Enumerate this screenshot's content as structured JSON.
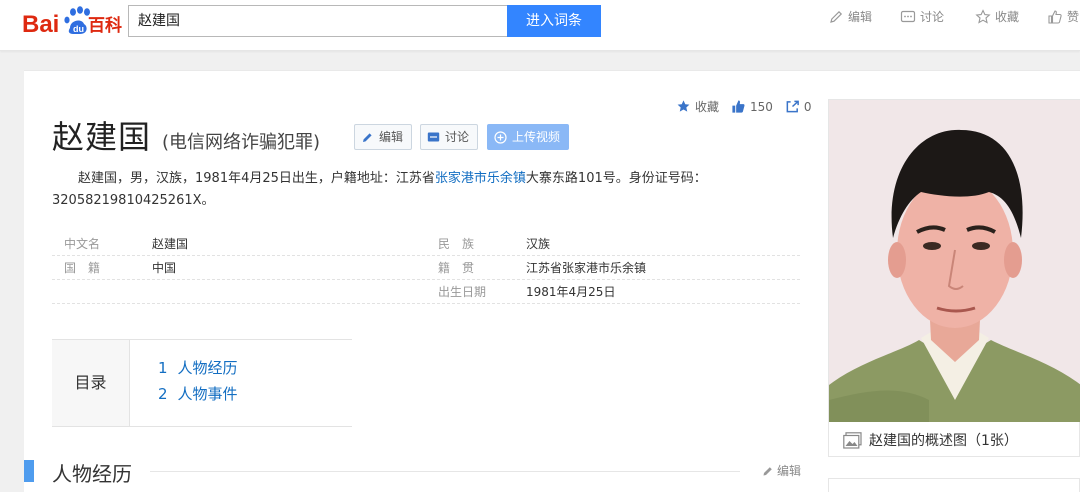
{
  "header": {
    "logo_text_left": "Bai",
    "logo_text_right": "百科",
    "search_value": "赵建国",
    "search_button": "进入词条",
    "actions": [
      "编辑",
      "讨论",
      "收藏",
      "赞"
    ]
  },
  "stats": {
    "collect_label": "收藏",
    "likes": "150",
    "shares": "0"
  },
  "entry": {
    "title": "赵建国",
    "subtitle": "(电信网络诈骗犯罪)",
    "edit_button": "编辑",
    "discuss_button": "讨论",
    "upload_button": "上传视频"
  },
  "summary": {
    "part1": "赵建国，男，汉族，1981年4月25日出生，户籍地址：江苏省",
    "link": "张家港市乐余镇",
    "part2": "大寨东路101号。身份证号码：",
    "part3": "32058219810425261X。"
  },
  "info": {
    "rows": [
      {
        "k1": "中文名",
        "v1": "赵建国",
        "k2": "民　族",
        "v2": "汉族"
      },
      {
        "k1": "国　籍",
        "v1": "中国",
        "k2": "籍　贯",
        "v2": "江苏省张家港市乐余镇"
      },
      {
        "k1": "",
        "v1": "",
        "k2": "出生日期",
        "v2": "1981年4月25日"
      }
    ]
  },
  "toc": {
    "label": "目录",
    "items": [
      {
        "num": "1",
        "text": "人物经历"
      },
      {
        "num": "2",
        "text": "人物事件"
      }
    ]
  },
  "section": {
    "title": "人物经历",
    "edit": "编辑"
  },
  "album": {
    "caption": "赵建国的概述图（1张）"
  },
  "colors": {
    "brand_blue": "#3385ff",
    "logo_red": "#de2910",
    "link": "#136ec2",
    "section_accent": "#4f9cee"
  }
}
